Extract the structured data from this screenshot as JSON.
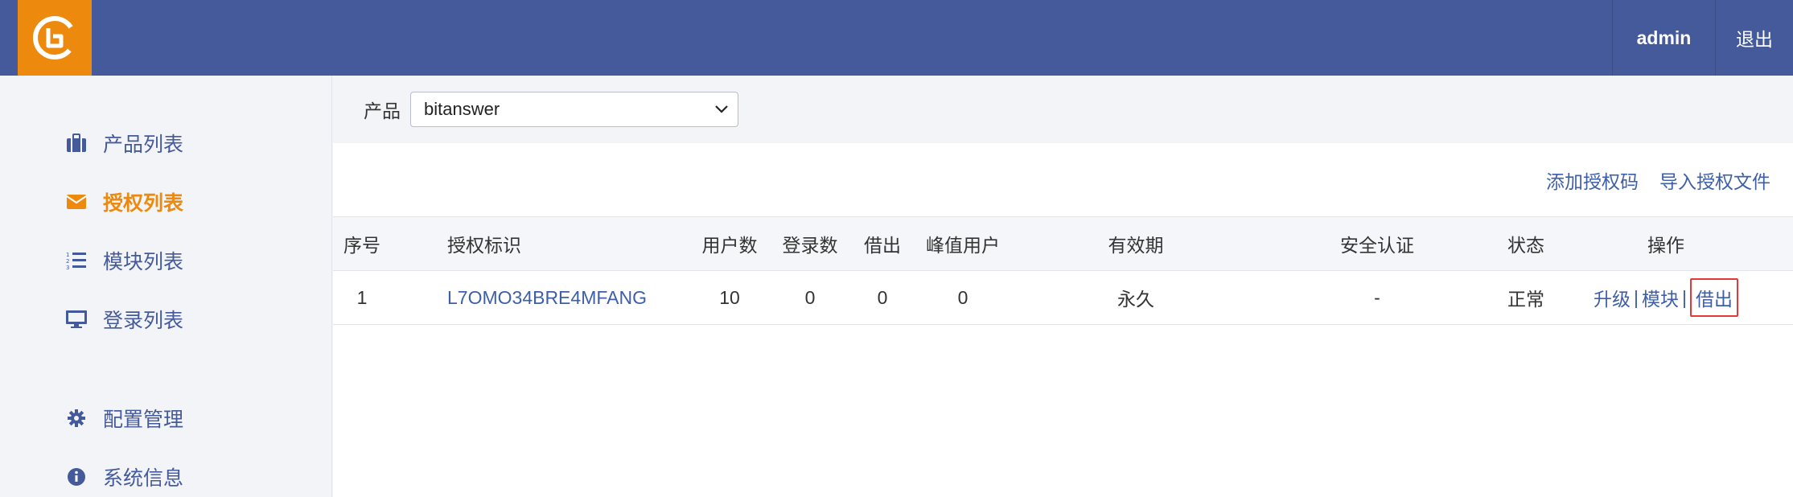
{
  "header": {
    "user": "admin",
    "logout": "退出"
  },
  "sidebar": {
    "items": [
      {
        "label": "产品列表",
        "icon": "briefcase-icon"
      },
      {
        "label": "授权列表",
        "icon": "envelope-icon",
        "active": true
      },
      {
        "label": "模块列表",
        "icon": "list-ol-icon"
      },
      {
        "label": "登录列表",
        "icon": "monitor-icon"
      },
      {
        "label": "配置管理",
        "icon": "gear-icon"
      },
      {
        "label": "系统信息",
        "icon": "info-circle-icon"
      }
    ]
  },
  "filter": {
    "label": "产品",
    "selected": "bitanswer"
  },
  "toolbar": {
    "add_code": "添加授权码",
    "import_file": "导入授权文件"
  },
  "table": {
    "columns": [
      "序号",
      "授权标识",
      "用户数",
      "登录数",
      "借出",
      "峰值用户",
      "有效期",
      "安全认证",
      "状态",
      "操作"
    ],
    "rows": [
      {
        "seq": "1",
        "id": "L7OMO34BRE4MFANG",
        "users": "10",
        "logins": "0",
        "borrowed": "0",
        "peak": "0",
        "validity": "永久",
        "security": "-",
        "status": "正常",
        "ops": {
          "upgrade": "升级",
          "module": "模块",
          "borrow": "借出",
          "sep": "|"
        }
      }
    ]
  },
  "colors": {
    "header_bg": "#445a9a",
    "accent": "#ed8a0e",
    "link": "#3e5fa8",
    "highlight_border": "#e5383b"
  }
}
